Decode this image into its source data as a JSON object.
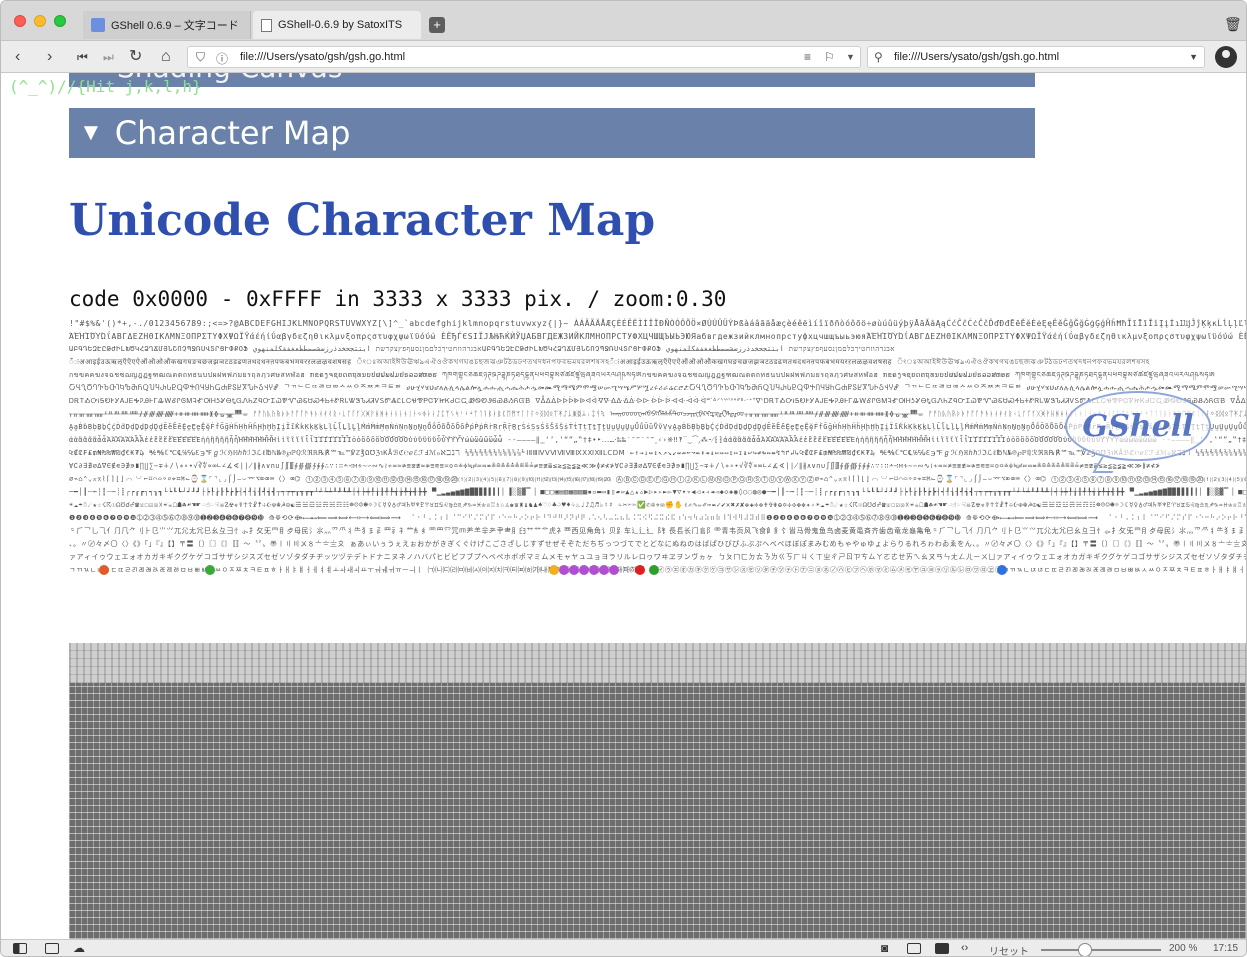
{
  "browser": {
    "tabs": [
      {
        "label": "GShell 0.6.9 – 文字コード",
        "favicon": "gshell-favicon-icon"
      },
      {
        "label": "GShell-0.6.9 by SatoxITS",
        "favicon": "document-icon"
      }
    ],
    "url": "file:///Users/ysato/gsh/gsh.go.html",
    "search_value": "file:///Users/ysato/gsh/gsh.go.html"
  },
  "page": {
    "overlay_hint": "(^_^)//{Hit j,k,l,h}",
    "section_prev": "Shading Canvas",
    "section_current": "Character Map",
    "section_toggle": "▼",
    "title": "Unicode Character Map",
    "code_line": "code 0x0000 - 0xFFFF in 3333 x 3333 pix. / zoom:0.30",
    "badge": "GShell"
  },
  "charmap_rows": [
    "!\"#$%&'()*+,-./0123456789:;<=>?@ABCDEFGHIJKLMNOPQRSTUVWXYZ[\\]^_`abcdefghijklmnopqrstuvwxyz{|}~ ÀÁÂÃÄÅÆÇÈÉÊËÌÍÎÏÐÑÒÓÔÕÖ×ØÙÚÛÜÝÞßàáâãäåæçèéêëìíîïðñòóôõö÷øùúûüýþÿĀāĂăĄąĆćĈĉĊċČčĎďĐđĒēĔĕĖėĘęĚěĜĝĞğĠġĢģĤĥĦħĨĩĪīĬĭĮįİıĲĳĴĵĶķĸĹĺĻļĽľĿŀŁłŃńŅņŇňŉŊŋŌōŎŏŐőŒœŔŕŖŗŘřŚśŜŝŞşŠšŢţŤťŦŧŨũŪūŬŭŮůŰűŲųŴŵŶŷŸŹźŻżŽž",
    "ΆΈΉΊΌΎΏΐΑΒΓΔΕΖΗΘΙΚΛΜΝΞΟΠΡΣΤΥΦΧΨΩΪΫάέήίΰαβγδεζηθικλμνξοπρςστυφχψωϊϋόύώ ЀЁЂЃЄЅІЇЈЉЊЋЌЍЎЏАБВГДЕЖЗИЙКЛМНОПРСТУФХЦЧШЩЪЫЬЭЮЯабвгдежзийклмнопрстуфхцчшщъыьэюя",
    "ԱԲԳԴԵԶԷԸԹԺԻԼԽԾԿՀՁՂՃՄՅՆՇՈՉՊՋՌՍՎՏՐՑՒՓՔՕՖ אבגדהוזחטיךכלםמןנסעףפץצקרשת ابتثجحخدذرزسشصضطظعغفقكلمنهوي",
    "ँंःअआइईउऊऋऌऍऎएऐऑऒओऔकखगघङचछजझञटठडढणतथदधनऩपफबभमयरऱलळऴवशषसह ঁংঃঅআইঈউঊঋঌএঐওঔকখগঘঙচছজঝঞটঠডঢণতথদধনপফবভমযরলশষসহ",
    "กขฃคฅฆงจฉชซฌญฎฏฐฑฒณดตถทธนบปผฝพฟภมยรฤลฦวศษสหฬอฮ ກຂຄງຈຊຍດຕຖທນບປຜຝພຟມຢຣລວສຫອຮ ཀཁགགྷངཅཆཇཉཊཋཌཌྷཎཏཐདདྷནཔཕབབྷམཙཚཛཛྷཝཞཟའཡརལཤཥསཧཨ",
    "ႠႡႢႣႤႥႦႧႨႩႪႫႬႭႮႯႰႱႲႳႴႵႶႷႸႹႺႻႼႽႾႿჀჁჂჃჄჅ ᄀᄁᄂᄃᄄᄅᄆᄇᄈᄉᄊᄋᄌᄍᄎᄏᄐᄑᄒ ሀሁሂሃሄህሆለሉሊላሌልሎሏሐሑሒሓሔሕሖሗመሙሚማሜምሞሟሠሡሢሣሤሥሦሧረሩሪራሬርሮሯ",
    "ᎠᎡᎢᎣᎤᎥᎦᎧᎨᎩᎪᎫᎬᎭᎮᎯᎰᎱᎲᎳᎴᎵᎶᎷᎸᎹᎺᎻᎼᎽᎾᎿᏀᏁᏂᏃᏄᏅᏆᏇᏈᏉᏊᏋᏌᏍᏎᏏᏐᏑᏒᏓᏔᏕᏖᏗᏘᏙᏚᏛᏜᏝᏞᏟᏠᏡᏢᏣᏤᏥᏦᏧᏨᏩᏪᏫᏬᏭᏮᏯᏰᏱᏲᏳᏴ ᐁᐂᐃᐄᐅᐆᐇᐈᐉᐊᐋᐌᐍᐎᐏᐐᐑᐒᐓᐔᐕᐖᐗᐘᐙᐚᐛᐜᐝᐞᐟᐠᐡᐢᐣᐤᐥᐦᐧᐨᐩᐪᐫ",
    "ᚁᚂᚃᚄᚅᚆᚇᚈᚉᚊᚋᚌᚍᚎᚏᚐᚑᚒᚓᚔᚕᚖᚗᚘᚙᚚ ᚠᚡᚢᚣᚤᚥᚦᚧᚨᚩᚪᚫᚬᚭᚮᚯᚰᚱᚲᚳᚴᚵᚶᚷᚸᚹᚺᚻᚼᚽᚾᚿᛀᛁᛂᛃᛄᛅᛆᛇᛈᛉᛊᛋᛌᛍᛎᛏᛐᛑᛒᛓᛔᛕᛖᛗᛘᛙᛚᛛᛜᛝᛞᛟᛠᛡᛢᛣᛤᛥᛦᛧᛨᛩᛪ ᠠᠡᠢᠣᠤᠥᠦᠧᠨᠩᠪᠫᠬᠭᠮᠯᠰᠱᠲᠳᠴᠵᠶᠷᠸᠹᠺᠻᠼᠽᠾᠿᡀᡁᡂ",
    "ḀḁḂḃḄḅḆḇḈḉḊḋḌḍḎḏḐḑḒḓḔḕḖḗḘḙḚḛḜḝḞḟḠḡḢḣḤḥḦḧḨḩḪḫḬḭḮḯḰḱḲḳḴḵḶḷḸḹḺḻḼḽḾḿṀṁṂṃṄṅṆṇṈṉṊṋṌṍṎṏṐṑṒṓṔṕṖṗṘṙṚṛṜṝṞṟṠṡṢṣṤṥṦṧṨṩṪṫṬṭṮṯṰṱṲṳṴṵṶṷṸṹṺṻṼṽṾṿ",
    "ἀἁἂἃἄἅἆἇἈἉἊἋἌἍἎἏἐἑἒἓἔἕἘἙἚἛἜἝἠἡἢἣἤἥἦἧἨἩἪἫἬἭἮἯἰἱἲἳἴἵἶἷἸἹἺἻἼἽἾἿὀὁὂὃὄὅὈὉὊὋὌὍὐὑὒὓὔὕὖὗὙὛὝὟὠὡὢὣὤὥὦὧ ‐‑‒–—―‖‗‘’‚‛“”„‟†‡•‣․‥…‧‰‱′″‴‵‶‷‸‹›※‼‽‾‿⁀⁁⁂⁃⁄⁅⁆",
    "₠₡₢₣₤₥₦₧₨₩₪₫€₭₮₯ ℀℁ℂ℃℄℅℆ℇ℈℉ℊℋℌℍℎℏℐℑℒℓ℔ℕ№℗℘ℙℚℛℜℝ℞℟℠℡™℣ℤ℥Ω℧ℨ℩KÅℬℭ℮ℯℰℱℲℳℴℵℶℷℸ ⅓⅔⅕⅖⅗⅘⅙⅚⅛⅜⅝⅞⅟ⅠⅡⅢⅣⅤⅥⅦⅧⅨⅩⅪⅫⅬⅭⅮⅯ ←↑→↓↔↕↖↗↘↙↚↛↜↝↞↟↠↡↢↣↤↥↦↧↨↩↪↫↬↭↮↯↰↱↲↳",
    "∀∁∂∃∄∅∆∇∈∉∊∋∌∍∎∏∐∑−∓∔∕∖∗∘∙√∛∜∝∞∟∠∡∢∣∤∥∦∧∨∩∪∫∬∭∮∯∰∱∲∳∴∵∶∷∸∹∺∻∼∽∾∿≀≁≂≃≄≅≆≇≈≉≊≋≌≍≎≏≐≑≒≓≔≕≖≗≘≙≚≛≜≝≞≟≠≡≢≣≤≥≦≧≨≩≪≫≬≭≮≯",
    "⌀⌁⌂⌃⌄⌅⌆⌇⌈⌉⌊⌋⌌⌍⌎⌏⌐⌑⌒⌓⌔⌕⌖⌗⌘⌙⌚⌛⌜⌝⌞⌟⌠⌡⌢⌣⌤⌥⌦⌧⌨〈〉⌫⌬ ①②③④⑤⑥⑦⑧⑨⑩⑪⑫⑬⑭⑮⑯⑰⑱⑲⑳⑴⑵⑶⑷⑸⑹⑺⑻⑼⑽⑾⑿⒀⒁⒂⒃⒄⒅⒆⒇ ⒶⒷⒸⒹⒺⒻⒼⒽⒾⒿⓀⓁⓂⓃⓄⓅⓆⓇⓈⓉⓊⓋⓌⓍⓎⓏ",
    "─━│┃┄┅┆┇┈┉┊┋┌┍┎┏┐┑┒┓└┕┖┗┘┙┚┛├┝┞┟┠┡┢┣┤┥┦┧┨┩┪┫┬┭┮┯┰┱┲┳┴┵┶┷┸┹┺┻┼┽┾┿╀╁╂╃╄╅╆╇╈╉╊╋ ▀▁▂▃▄▅▆▇█▉▊▋▌▍▎▏▐░▒▓▔▕ ■□▢▣▤▥▦▧▨▩▪▫▬▭▮▯▰▱▲△▴▵▶▷▸▹►▻▼▽▾▿◀◁◂◃◄◅◆◇◈◉◊○◌◍◎●",
    "☀☁☂☃☄★☆☇☈☉☊☋☌☍☎☏☐☑☒☓☔☕☖☗☘☙☚☛☜☝☞☟☠☡☢☣☤☥☦☧☨☩☪☫☬☭☮☯☰☱☲☳☴☵☶☷☸☹☺☻☼☽☾☿♀♁♂♃♄♅♆♇♈♉♊♋♌♍♎♏♐♑♒♓♔♕♖♗♘♙♚♛♜♝♞♟♠♡♢♣♤♥♦♧♨♩♪♫♬♭♮♯ ✁✂✃✄✅✆✇✈✉✊✋✌✍✎✏✐✑✒✓✔✕✖✗✘✙✚✛✜✝✞✟✠✡✢✣✤✥✦✧",
    "❶❷❸❹❺❻❼❽❾❿➀➁➂➃➄➅➆➇➈➉➊➋➌➍➎➏➐➑➒➓ ⟰⟱⟲⟳⟴⟵⟶⟷⟸⟹⟺⟻⟼⟽⟾⟿ ⠀⠁⠂⠃⠄⠅⠆⠇⠈⠉⠊⠋⠌⠍⠎⠏⠐⠑⠒⠓⠔⠕⠖⠗⠘⠙⠚⠛⠜⠝⠞⠟⠠⠡⠢⠣⠤⠥⠦⠧⠨⠩⠪⠫⠬⠭⠮⠯⠰⠱⠲⠳⠴⠵⠶⠷⠸⠹⠺⠻⠼⠽⠾⠿",
    "⺀⺁⺂⺃⺄⺅⺆⺇⺈⺉⺊⺋⺌⺍⺎⺏⺐⺑⺒⺓⺔⺕⺖⺗⺘⺙⺛⺜⺝⺞⺟⺠⺡⺢⺣⺤⺥⺦⺧⺨⺩⺪⺫⺬⺭⺮⺯⺰⺱⺲⺳⺴⺵⺶⺷⺸⺹⺺⺻⺼⺽⺾⺿⻀⻁⻂⻃⻄⻅⻆⻇⻈⻉⻊⻋⻌⻍⻎⻏⻐⻑⻒⻓⻔⻕⻖⻗⻘⻙⻚⻛⻜⻝⻞⻟⻠⻡⻢⻣⻤⻥⻦⻧⻨⻩⻪⻫⻬⻭⻮⻯⻰⻱⻲⻳",
    "、。〃〄々〆〇〈〉《》「」『』【】〒〓〔〕〖〗〘〙〚〛〜〝〞〟〠〡〢〣〤〥〦〧〨〩 ぁあぃいぅうぇえぉおかがきぎくぐけげこごさざしじすずせぜそぞただちぢっつづてでとどなにぬねのはばぱひびぴふぶぷへべぺほぼぽまみむめもゃやゅゆょよらりるれろゎわゐゑをん",
    "ァアィイゥウェエォオカガキギクグケゲコゴサザシジスズセゼソゾタダチヂッツヅテデトドナニヌネノハバパヒビピフブプヘベペホボポマミムメモャヤュユョヨラリルレロヮワヰヱヲンヴヵヶ ㄅㄆㄇㄈㄉㄊㄋㄌㄍㄎㄏㄐㄑㄒㄓㄔㄕㄖㄗㄘㄙㄚㄛㄜㄝㄞㄟㄠㄡㄢㄣㄤㄥㄦㄧㄨㄩ",
    "ㄱㄲㄳㄴㄵㄶㄷㄸㄹㄺㄻㄼㄽㄾㄿㅀㅁㅂㅃㅄㅅㅆㅇㅈㅉㅊㅋㅌㅍㅎㅏㅐㅑㅒㅓㅔㅕㅖㅗㅘㅙㅚㅛㅜㅝㅞㅟㅠㅡㅢㅣ ㈀㈁㈂㈃㈄㈅㈆㈇㈈㈉㈊㈋㈌㈍㈎㈏㈐㈑㈒㈓㈔㈕㈖㈗㈘㈙㈚㈛㈜ ㋐㋑㋒㋓㋔㋕㋖㋗㋘㋙㋚㋛㋜㋝㋞㋟㋠㋡㋢㋣㋤㋥㋦㋧㋨㋩㋪㋫㋬㋭㋮㋯㋰㋱㋲㋳㋴㋵㋶㋷㋸㋹㋺㋻㋼㋽㋾"
  ],
  "emoji_colors": [
    "#e05a2a",
    "#3aa93a",
    "#f0b020",
    "#b050d0",
    "#b050d0",
    "#b050d0",
    "#b050d0",
    "#b050d0",
    "#b050d0",
    "#e02020",
    "#2e9e2e",
    "#3070e0"
  ],
  "statusbar": {
    "reset_label": "リセット",
    "zoom_label": "200 %",
    "clock": "17:15"
  }
}
